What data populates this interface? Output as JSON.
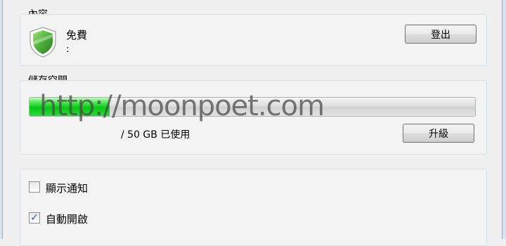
{
  "account": {
    "group_label": "內容",
    "plan": "免費",
    "plan_detail": ":",
    "signout_label": "登出"
  },
  "storage": {
    "group_label": "儲存空間",
    "usage_text": "/ 50 GB 已使用",
    "used_fraction": 0.18,
    "upgrade_label": "升級",
    "watermark": "http://moonpoet.com"
  },
  "options": {
    "items": [
      {
        "label": "顯示通知",
        "checked": false
      },
      {
        "label": "自動開啟",
        "checked": true
      }
    ]
  },
  "colors": {
    "progress_fill": "#08c618",
    "shield": "#4caf3a"
  }
}
